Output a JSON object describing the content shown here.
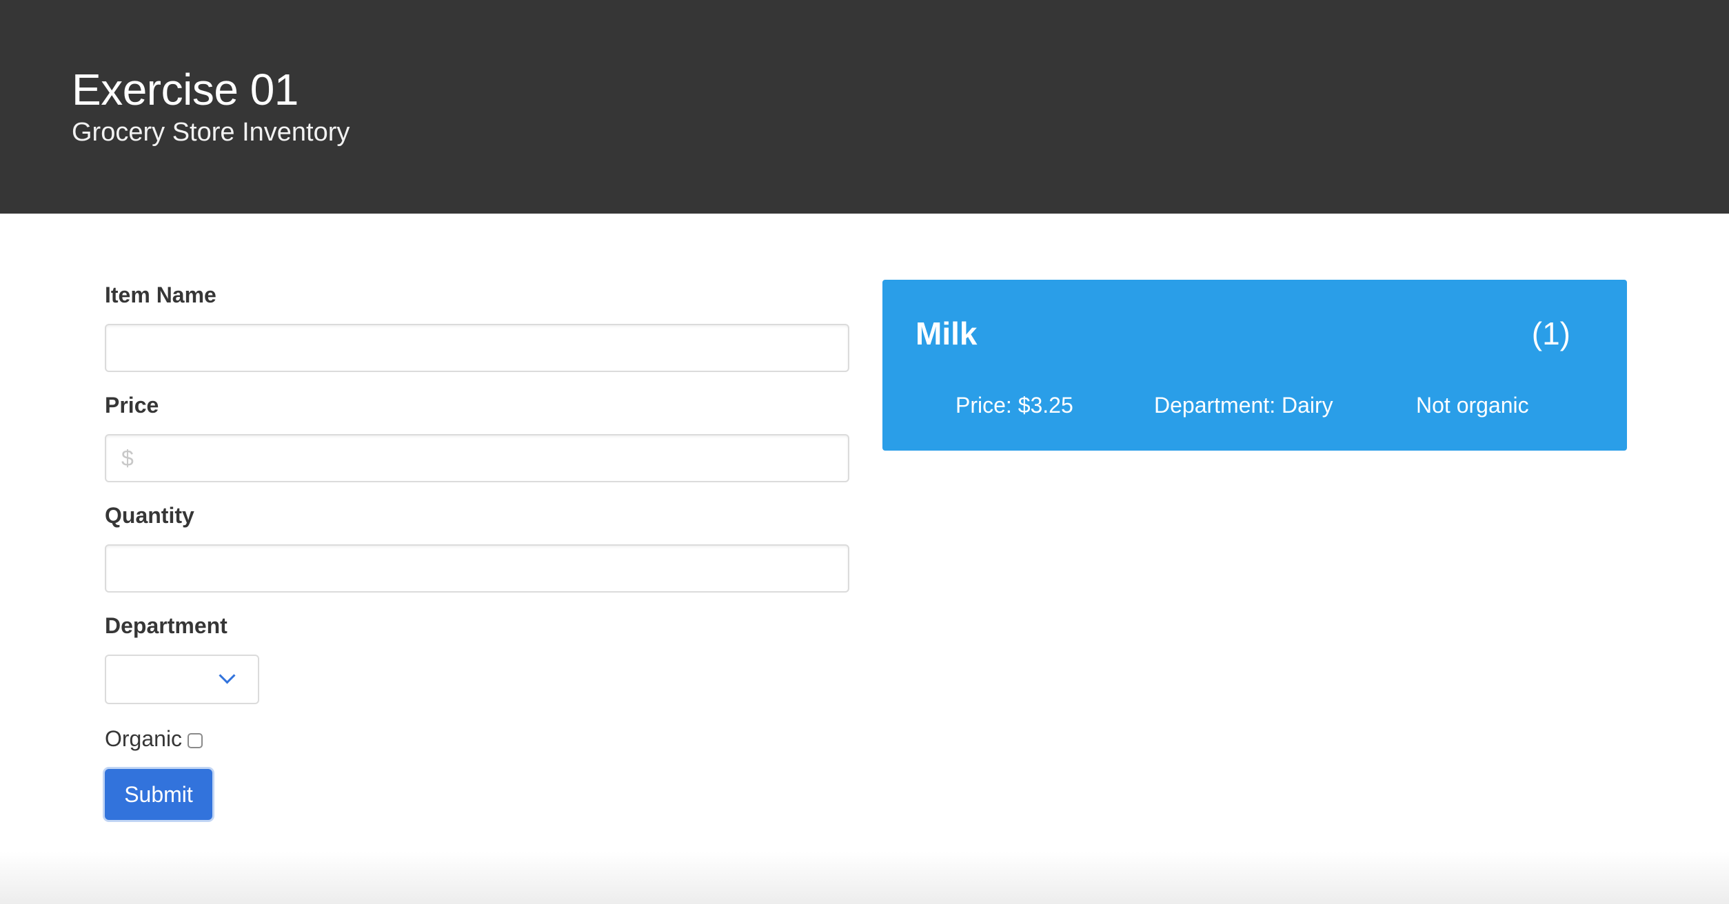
{
  "hero": {
    "title": "Exercise 01",
    "subtitle": "Grocery Store Inventory"
  },
  "form": {
    "item_name": {
      "label": "Item Name",
      "value": "",
      "placeholder": ""
    },
    "price": {
      "label": "Price",
      "value": "",
      "placeholder": "$"
    },
    "quantity": {
      "label": "Quantity",
      "value": "",
      "placeholder": ""
    },
    "department": {
      "label": "Department",
      "selected": ""
    },
    "organic": {
      "label": "Organic",
      "checked": false
    },
    "submit_label": "Submit"
  },
  "items": [
    {
      "name": "Milk",
      "quantity_text": "(1)",
      "price_text": "Price: $3.25",
      "department_text": "Department: Dairy",
      "organic_text": "Not organic"
    }
  ],
  "colors": {
    "hero_bg": "#363636",
    "card_bg": "#2a9ee8",
    "primary": "#3273dc"
  }
}
